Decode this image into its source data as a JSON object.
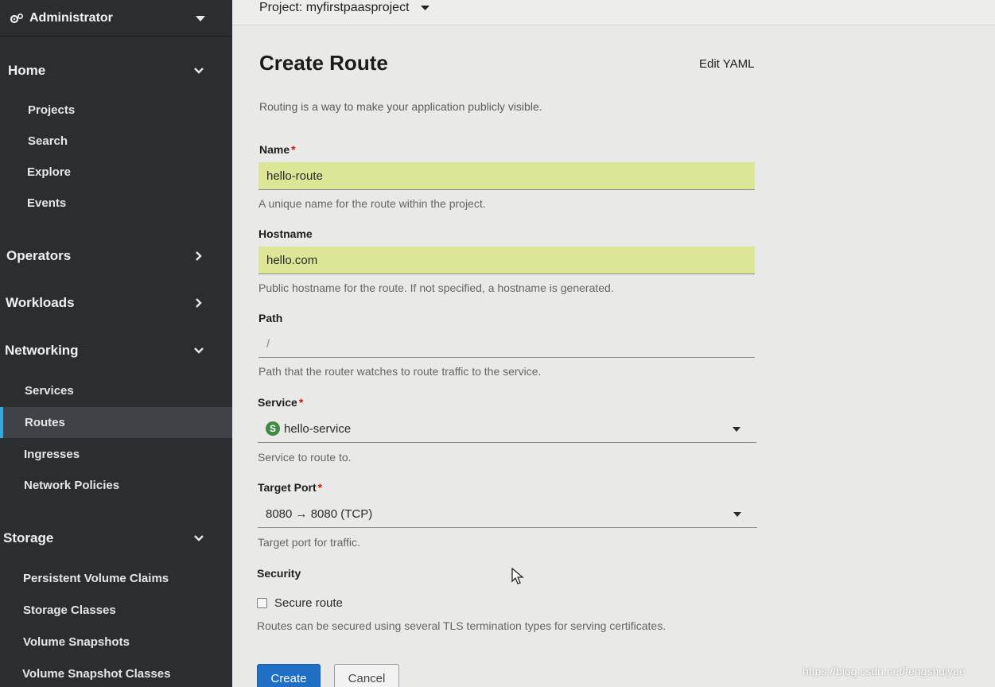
{
  "sidebar": {
    "perspective": "Administrator",
    "sections": [
      {
        "label": "Home",
        "items": [
          "Projects",
          "Search",
          "Explore",
          "Events"
        ]
      },
      {
        "label": "Operators"
      },
      {
        "label": "Workloads"
      },
      {
        "label": "Networking",
        "items": [
          "Services",
          "Routes",
          "Ingresses",
          "Network Policies"
        ]
      },
      {
        "label": "Storage",
        "items": [
          "Persistent Volume Claims",
          "Storage Classes",
          "Volume Snapshots",
          "Volume Snapshot Classes"
        ]
      }
    ],
    "active_item": "Routes"
  },
  "topbar": {
    "project_label": "Project: myfirstpaasproject"
  },
  "page": {
    "title": "Create Route",
    "edit_yaml": "Edit YAML",
    "intro": "Routing is a way to make your application publicly visible."
  },
  "form": {
    "name": {
      "label": "Name",
      "required": "*",
      "value": "hello-route",
      "help": "A unique name for the route within the project."
    },
    "hostname": {
      "label": "Hostname",
      "value": "hello.com",
      "help": "Public hostname for the route. If not specified, a hostname is generated."
    },
    "path": {
      "label": "Path",
      "placeholder": "/",
      "help": "Path that the router watches to route traffic to the service."
    },
    "service": {
      "label": "Service",
      "required": "*",
      "badge": "S",
      "value": "hello-service",
      "help": "Service to route to."
    },
    "target_port": {
      "label": "Target Port",
      "required": "*",
      "value": "8080 → 8080 (TCP)",
      "help": "Target port for traffic."
    },
    "security": {
      "label": "Security",
      "checkbox_label": "Secure route",
      "checked": false,
      "help": "Routes can be secured using several TLS termination types for serving certificates."
    }
  },
  "actions": {
    "create": "Create",
    "cancel": "Cancel"
  },
  "watermark": "https://blog.csdn.net/fengshuiyue",
  "colors": {
    "sidebar_bg": "#2b2e31",
    "active_item_bg": "#3f4347",
    "active_accent": "#39a5dc",
    "filled_field_bg": "#dde596",
    "primary_button": "#1f6fc5",
    "required_marker": "#c9190b"
  }
}
